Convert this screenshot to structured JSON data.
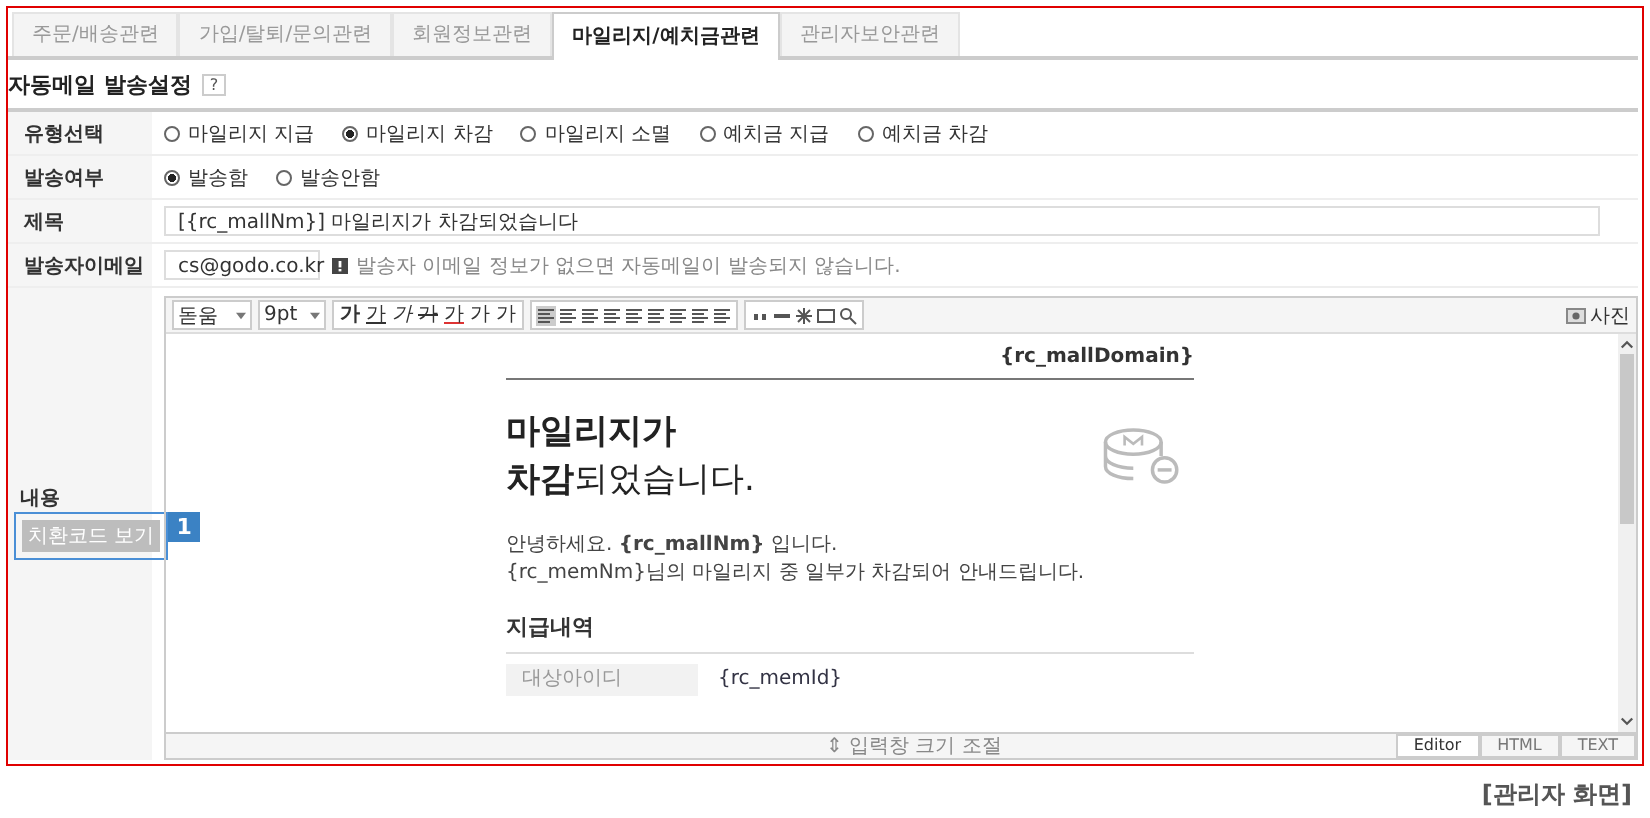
{
  "tabs": [
    {
      "label": "주문/배송관련",
      "selected": false
    },
    {
      "label": "가입/탈퇴/문의관련",
      "selected": false
    },
    {
      "label": "회원정보관련",
      "selected": false
    },
    {
      "label": "마일리지/예치금관련",
      "selected": true
    },
    {
      "label": "관리자보안관련",
      "selected": false
    }
  ],
  "section": {
    "title": "자동메일 발송설정",
    "help": "?"
  },
  "form": {
    "type": {
      "label": "유형선택",
      "options": [
        {
          "label": "마일리지 지급",
          "selected": false
        },
        {
          "label": "마일리지 차감",
          "selected": true
        },
        {
          "label": "마일리지 소멸",
          "selected": false
        },
        {
          "label": "예치금 지급",
          "selected": false
        },
        {
          "label": "예치금 차감",
          "selected": false
        }
      ]
    },
    "send": {
      "label": "발송여부",
      "options": [
        {
          "label": "발송함",
          "selected": true
        },
        {
          "label": "발송안함",
          "selected": false
        }
      ]
    },
    "subject": {
      "label": "제목",
      "value": "[{rc_mallNm}] 마일리지가 차감되었습니다"
    },
    "sender": {
      "label": "발송자이메일",
      "value": "cs@godo.co.kr",
      "note": "발송자 이메일 정보가 없으면 자동메일이 발송되지 않습니다."
    },
    "content": {
      "label": "내용",
      "code_button": "치환코드 보기",
      "badge": "1"
    }
  },
  "editor": {
    "font": "돋움",
    "size": "9pt",
    "glyphs": [
      {
        "label": "가",
        "kind": "bold"
      },
      {
        "label": "가",
        "kind": "underline"
      },
      {
        "label": "가",
        "kind": "italic"
      },
      {
        "label": "가",
        "kind": "strike"
      },
      {
        "label": "가",
        "kind": "color"
      },
      {
        "label": "가",
        "kind": "sup"
      },
      {
        "label": "가",
        "kind": "sub"
      }
    ],
    "photo_button": "사진",
    "mail": {
      "domain": "{rc_mallDomain}",
      "headline_1": "마일리지가",
      "headline_2": "**차감**되었습니다.",
      "greeting": "안녕하세요. **{rc_mallNm}** 입니다.",
      "message": "{rc_memNm}님의 마일리지 중 일부가 차감되어 안내드립니다.",
      "section": "지급내역",
      "rows": [
        {
          "key": "대상아이디",
          "value": "{rc_memId}"
        }
      ]
    },
    "resize": "⇕ 입력창 크기 조절",
    "modes": [
      {
        "label": "Editor",
        "selected": true
      },
      {
        "label": "HTML",
        "selected": false
      },
      {
        "label": "TEXT",
        "selected": false
      }
    ]
  },
  "caption": "[관리자 화면]"
}
